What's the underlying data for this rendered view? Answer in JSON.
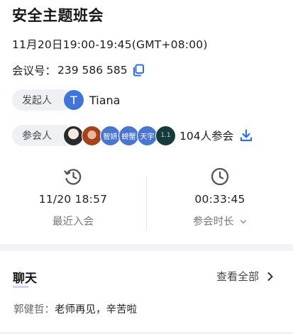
{
  "meeting": {
    "title": "安全主题班会",
    "time": "11月20日19:00-19:45(GMT+08:00)",
    "id_label": "会议号：",
    "id_value": "239 586 585"
  },
  "initiator": {
    "label": "发起人",
    "avatar_letter": "T",
    "name": "Tiana"
  },
  "participants": {
    "label": "参会人",
    "avatars": [
      "",
      "",
      "智妍",
      "螃蟹",
      "天宇",
      "1.1"
    ],
    "count_text": "104人参会"
  },
  "stats": {
    "last_join_value": "11/20 18:57",
    "last_join_label": "最近入会",
    "duration_value": "00:33:45",
    "duration_label": "参会时长"
  },
  "chat": {
    "title": "聊天",
    "view_all": "查看全部",
    "sender": "郭健哲：",
    "message": "老师再见，辛苦啦"
  },
  "colors": {
    "accent": "#2e6fe0",
    "pill_bg": "#eef0f3",
    "avatar_blue": "#4b76cf"
  },
  "icons": {
    "copy": "copy-icon",
    "download": "download-icon",
    "history": "history-clock-icon",
    "clock": "clock-icon",
    "chevron": "chevron-right-icon"
  }
}
